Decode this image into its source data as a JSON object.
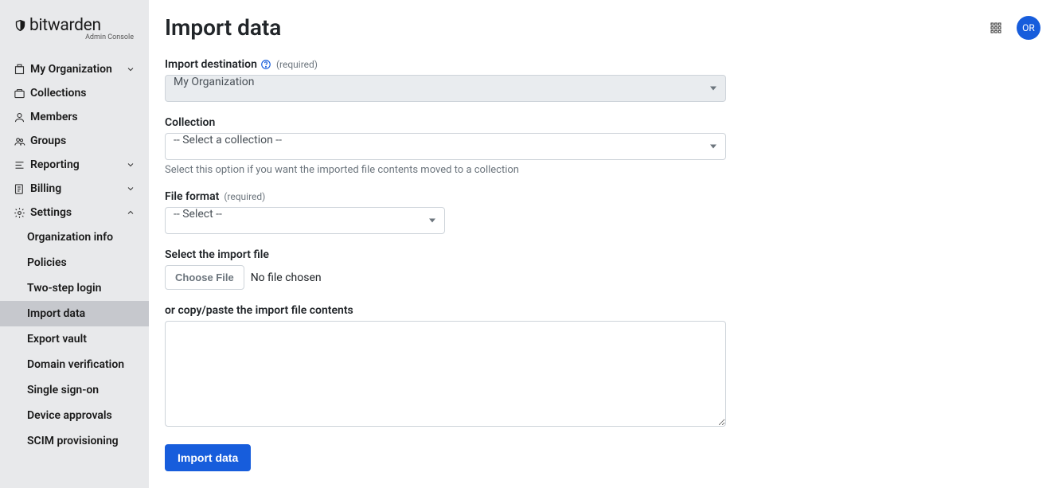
{
  "brand": {
    "name": "bitwarden",
    "subtitle": "Admin Console"
  },
  "sidebar": {
    "items": [
      {
        "label": "My Organization",
        "expandable": true,
        "expanded": false
      },
      {
        "label": "Collections",
        "expandable": false
      },
      {
        "label": "Members",
        "expandable": false
      },
      {
        "label": "Groups",
        "expandable": false
      },
      {
        "label": "Reporting",
        "expandable": true,
        "expanded": false
      },
      {
        "label": "Billing",
        "expandable": true,
        "expanded": false
      },
      {
        "label": "Settings",
        "expandable": true,
        "expanded": true
      }
    ],
    "settings_sub": [
      {
        "label": "Organization info",
        "active": false
      },
      {
        "label": "Policies",
        "active": false
      },
      {
        "label": "Two-step login",
        "active": false
      },
      {
        "label": "Import data",
        "active": true
      },
      {
        "label": "Export vault",
        "active": false
      },
      {
        "label": "Domain verification",
        "active": false
      },
      {
        "label": "Single sign-on",
        "active": false
      },
      {
        "label": "Device approvals",
        "active": false
      },
      {
        "label": "SCIM provisioning",
        "active": false
      }
    ]
  },
  "header": {
    "title": "Import data",
    "avatar_initials": "OR"
  },
  "form": {
    "destination": {
      "label": "Import destination",
      "required_text": "(required)",
      "value": "My Organization"
    },
    "collection": {
      "label": "Collection",
      "value": "-- Select a collection --",
      "helper": "Select this option if you want the imported file contents moved to a collection"
    },
    "file_format": {
      "label": "File format",
      "required_text": "(required)",
      "value": "-- Select --"
    },
    "file_select": {
      "label": "Select the import file",
      "button": "Choose File",
      "status": "No file chosen"
    },
    "paste": {
      "label": "or copy/paste the import file contents",
      "value": ""
    },
    "submit_label": "Import data"
  }
}
